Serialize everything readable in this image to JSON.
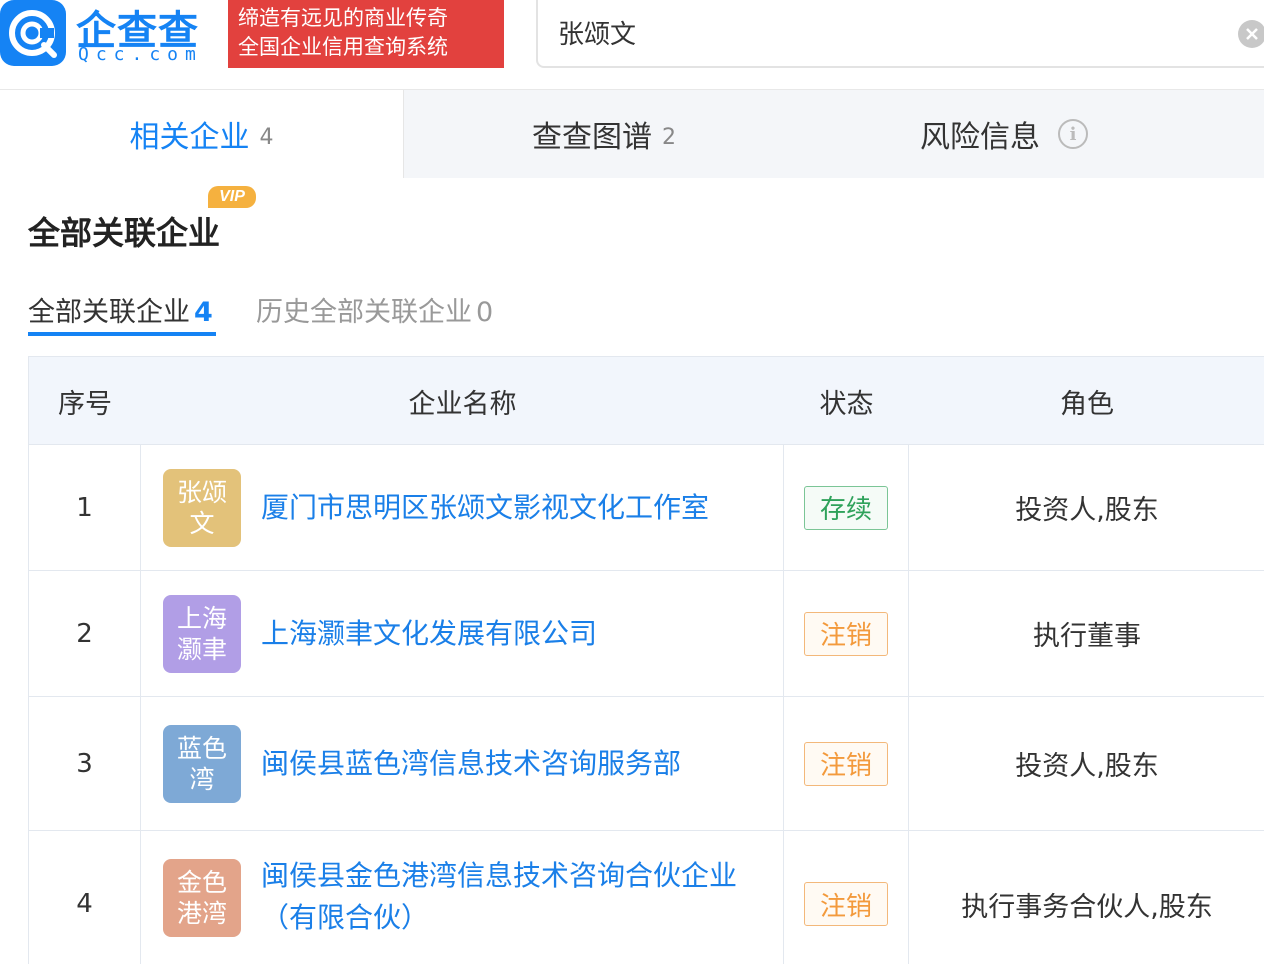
{
  "header": {
    "logo_cn": "企查查",
    "logo_en": "Qcc.com",
    "slogan_line1": "缔造有远见的商业传奇",
    "slogan_line2": "全国企业信用查询系统",
    "search_value": "张颂文",
    "brand_color": "#1583f4",
    "slogan_bg": "#e2413e"
  },
  "tabs": [
    {
      "label": "相关企业",
      "count": "4"
    },
    {
      "label": "查查图谱",
      "count": "2"
    },
    {
      "label": "风险信息",
      "icon": "info-icon"
    }
  ],
  "section": {
    "title": "全部关联企业",
    "vip": "VIP"
  },
  "subtabs": [
    {
      "label": "全部关联企业",
      "count": "4"
    },
    {
      "label": "历史全部关联企业",
      "count": "0"
    }
  ],
  "table": {
    "headers": [
      "序号",
      "企业名称",
      "状态",
      "角色"
    ],
    "rows": [
      {
        "idx": "1",
        "avatar_line1": "张颂",
        "avatar_line2": "文",
        "avatar_color": "#e3c27a",
        "name": "厦门市思明区张颂文影视文化工作室",
        "name_line2": "",
        "status": "存续",
        "role": "投资人,股东"
      },
      {
        "idx": "2",
        "avatar_line1": "上海",
        "avatar_line2": "灏聿",
        "avatar_color": "#b19ee6",
        "name": "上海灏聿文化发展有限公司",
        "name_line2": "",
        "status": "注销",
        "role": "执行董事"
      },
      {
        "idx": "3",
        "avatar_line1": "蓝色",
        "avatar_line2": "湾",
        "avatar_color": "#7ea9d6",
        "name": "闽侯县蓝色湾信息技术咨询服务部",
        "name_line2": "",
        "status": "注销",
        "role": "投资人,股东"
      },
      {
        "idx": "4",
        "avatar_line1": "金色",
        "avatar_line2": "港湾",
        "avatar_color": "#e3a48a",
        "name": "闽侯县金色港湾信息技术咨询合伙企业",
        "name_line2": "（有限合伙）",
        "status": "注销",
        "role": "执行事务合伙人,股东"
      }
    ]
  }
}
